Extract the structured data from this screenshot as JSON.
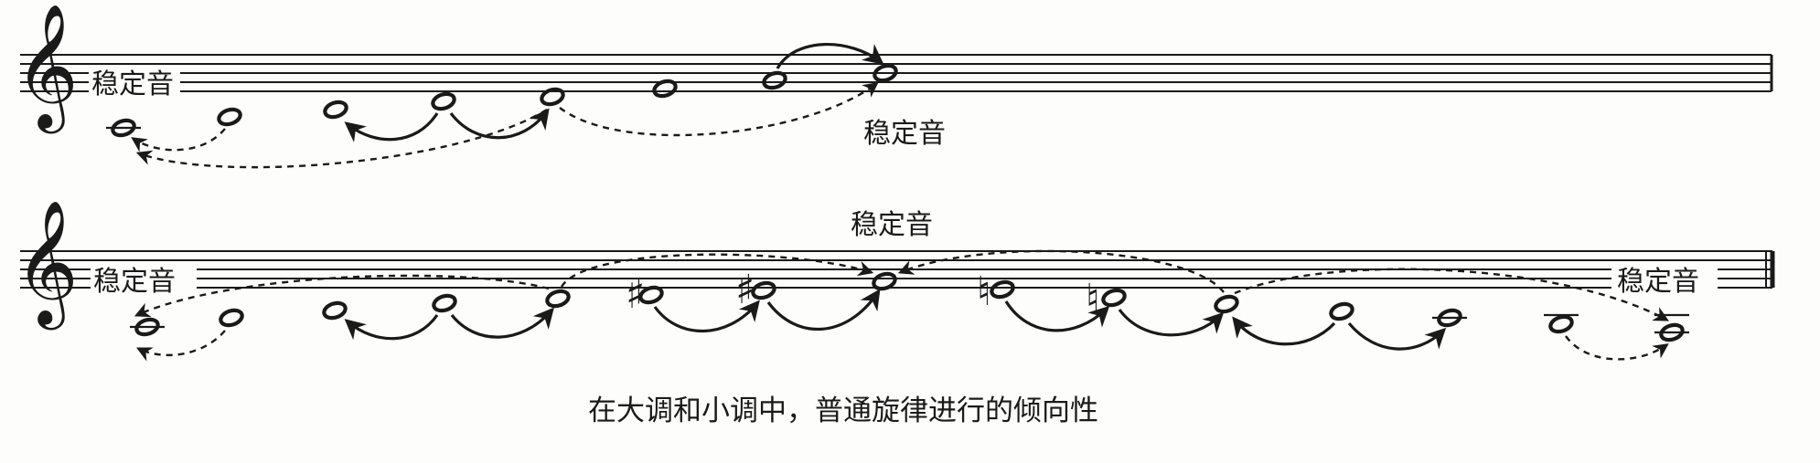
{
  "labels": {
    "stable_tone": "稳定音"
  },
  "caption": "在大调和小调中，普通旋律进行的倾向性",
  "clef": "𝄞",
  "accidentals": {
    "sharp": "♯",
    "natural": "♮"
  },
  "staff1": {
    "notes": [
      "C4",
      "D4",
      "E4",
      "F4",
      "G4",
      "A4",
      "B4",
      "C5"
    ],
    "tendencies": [
      {
        "from": "D4",
        "to": "C4",
        "style": "dashed"
      },
      {
        "from": "F4",
        "to": "E4",
        "style": "solid"
      },
      {
        "from": "F4",
        "to": "G4",
        "style": "solid"
      },
      {
        "from": "B4",
        "to": "C5",
        "style": "solid"
      },
      {
        "from": "G4",
        "to": "C5",
        "style": "dashed"
      },
      {
        "from": "G4",
        "to": "C4",
        "style": "dashed"
      }
    ]
  },
  "staff2": {
    "notes": [
      "C4",
      "D4",
      "E4",
      "F4",
      "G4",
      "♯F4",
      "♯G4",
      "A4",
      "♮G4",
      "♮F4",
      "E4",
      "D4",
      "C4",
      "B3",
      "A3"
    ],
    "tendencies": [
      {
        "from": "B3",
        "to": "A3",
        "style": "dashed"
      },
      {
        "from": "E4",
        "to": "A3",
        "style": "dashed"
      },
      {
        "from": "D4",
        "to": "C4",
        "style": "dashed"
      },
      {
        "from": "F4",
        "to": "E4",
        "style": "solid"
      },
      {
        "from": "F4",
        "to": "G4",
        "style": "solid"
      },
      {
        "from": "♯F4",
        "to": "♯G4",
        "style": "solid"
      },
      {
        "from": "♯G4",
        "to": "A4",
        "style": "solid"
      },
      {
        "from": "E4",
        "to": "A4",
        "style": "dashed"
      },
      {
        "from": "♮F4",
        "to": "E4",
        "style": "solid"
      },
      {
        "from": "D4",
        "to": "E4",
        "style": "solid"
      },
      {
        "from": "C4",
        "to": "B3",
        "style": "solid"
      },
      {
        "from": "B3",
        "to": "A3",
        "style": "solid"
      },
      {
        "from": "G4",
        "to": "A4",
        "style": "dashed"
      },
      {
        "from": "E4",
        "to": "A3",
        "style": "dashed"
      }
    ]
  }
}
